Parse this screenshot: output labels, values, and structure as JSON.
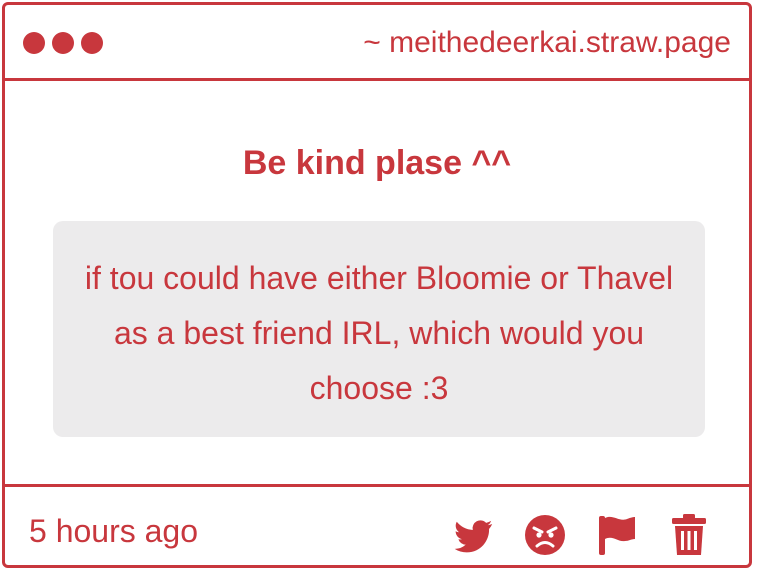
{
  "window": {
    "domain": "~ meithedeerkai.straw.page"
  },
  "main": {
    "heading": "Be kind plase ^^",
    "question": "if tou could have either Bloomie or Thavel as a best friend IRL, which would you choose :3"
  },
  "footer": {
    "timestamp": "5 hours ago",
    "actions": [
      "twitter-icon",
      "angry-face-icon",
      "flag-icon",
      "trash-icon"
    ]
  },
  "colors": {
    "accent": "#c8373d",
    "box_background": "#ecebec",
    "page_background": "#ffffff"
  }
}
